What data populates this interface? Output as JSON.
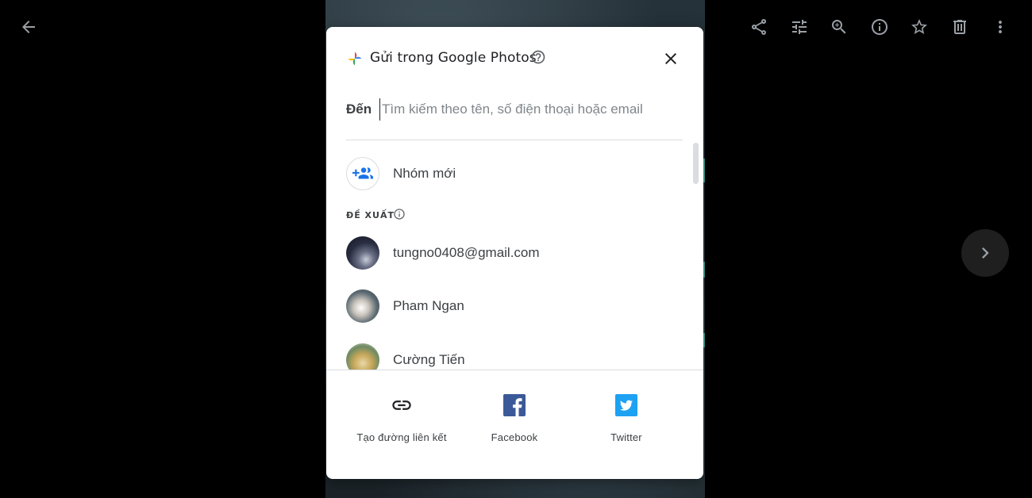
{
  "dialog": {
    "title": "Gửi trong Google Photos",
    "to_label": "Đến",
    "search_placeholder": "Tìm kiếm theo tên, số điện thoại hoặc email",
    "new_group_label": "Nhóm mới",
    "suggestions_label": "ĐỀ XUẤT",
    "contacts": [
      {
        "name": "tungno0408@gmail.com"
      },
      {
        "name": "Pham Ngan"
      },
      {
        "name": "Cường Tiến"
      }
    ],
    "share_options": [
      {
        "label": "Tạo đường liên kết",
        "icon": "link-icon"
      },
      {
        "label": "Facebook",
        "icon": "facebook-icon"
      },
      {
        "label": "Twitter",
        "icon": "twitter-icon"
      }
    ]
  },
  "toolbar": {
    "icons": [
      "back-arrow-icon",
      "share-icon",
      "edit-icon",
      "zoom-in-icon",
      "info-icon",
      "star-icon",
      "trash-icon",
      "more-vert-icon"
    ]
  },
  "navigation": {
    "next_icon": "chevron-right-icon"
  },
  "colors": {
    "accent": "#1a73e8",
    "facebook": "#3b5998",
    "twitter": "#1da1f2"
  }
}
